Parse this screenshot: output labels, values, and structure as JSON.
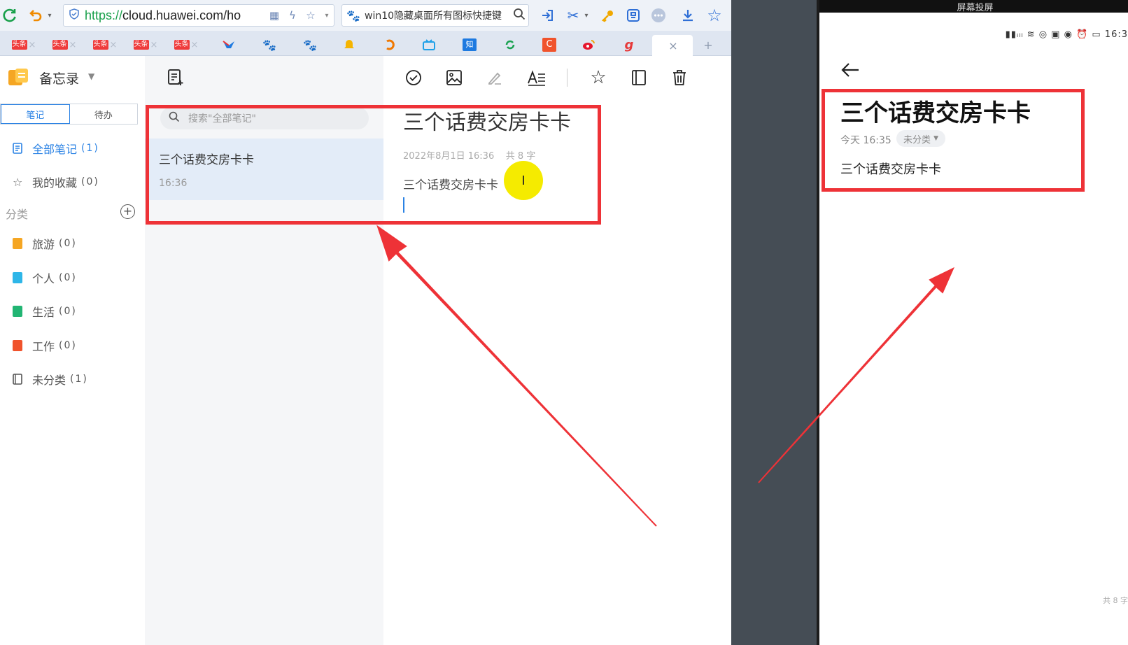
{
  "browser": {
    "url_scheme": "https://",
    "url_rest": "cloud.huawei.com/ho",
    "search_query": "win10隐藏桌面所有图标快捷键",
    "tab_zhi": "知",
    "tab_g": "g",
    "tab_c": "C",
    "new_tab": "+",
    "close_tab": "×",
    "toutiao": "头条"
  },
  "app": {
    "title": "备忘录",
    "segments": [
      "笔记",
      "待办"
    ],
    "nav": [
      {
        "label": "全部笔记",
        "count": "(1)"
      },
      {
        "label": "我的收藏",
        "count": "(0)"
      }
    ],
    "categories_header": "分类",
    "categories": [
      {
        "label": "旅游",
        "count": "(0)",
        "color": "#f5a623"
      },
      {
        "label": "个人",
        "count": "(0)",
        "color": "#2eb6e8"
      },
      {
        "label": "生活",
        "count": "(0)",
        "color": "#22b573"
      },
      {
        "label": "工作",
        "count": "(0)",
        "color": "#f0532c"
      },
      {
        "label": "未分类",
        "count": "(1)",
        "color": "#666666"
      }
    ]
  },
  "list": {
    "search_placeholder": "搜索\"全部笔记\"",
    "note_title": "三个话费交房卡卡",
    "note_time": "16:36"
  },
  "editor": {
    "title": "三个话费交房卡卡",
    "meta_date": "2022年8月1日 16:36",
    "meta_count": "共 8 字",
    "body": "三个话费交房卡卡",
    "cursor_glyph": "I"
  },
  "phone": {
    "top_title": "屏幕投屏",
    "status_time": "16:3",
    "title": "三个话费交房卡卡",
    "date": "今天 16:35",
    "category": "未分类",
    "body": "三个话费交房卡卡",
    "count": "共 8 字"
  },
  "colors": {
    "accent": "#2a82e4",
    "annotation": "#ee3237",
    "highlight": "#f5eb00"
  }
}
